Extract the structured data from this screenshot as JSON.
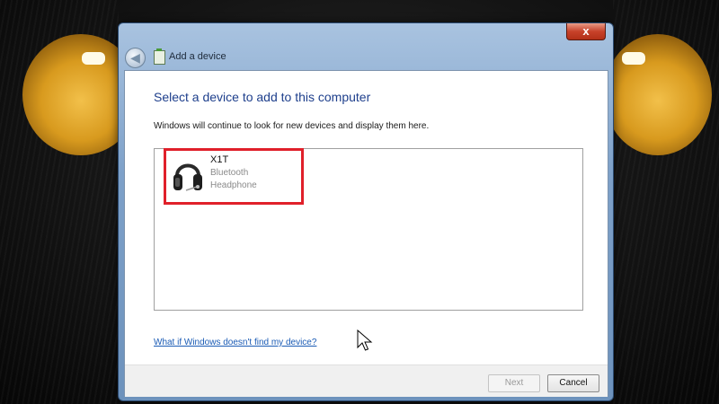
{
  "window": {
    "title": "Add a device",
    "close_label": "x",
    "back_glyph": "◀"
  },
  "content": {
    "heading": "Select a device to add to this computer",
    "subtext": "Windows will continue to look for new devices and display them here.",
    "devices": [
      {
        "name": "X1T",
        "type_line1": "Bluetooth",
        "type_line2": "Headphone",
        "icon": "headphone-icon",
        "highlight_color": "#e0202a"
      }
    ],
    "help_link": "What if Windows doesn't find my device?"
  },
  "footer": {
    "next_label": "Next",
    "cancel_label": "Cancel"
  },
  "colors": {
    "heading": "#1e3f8c",
    "link": "#1a5bb5",
    "selection_border": "#e0202a"
  }
}
